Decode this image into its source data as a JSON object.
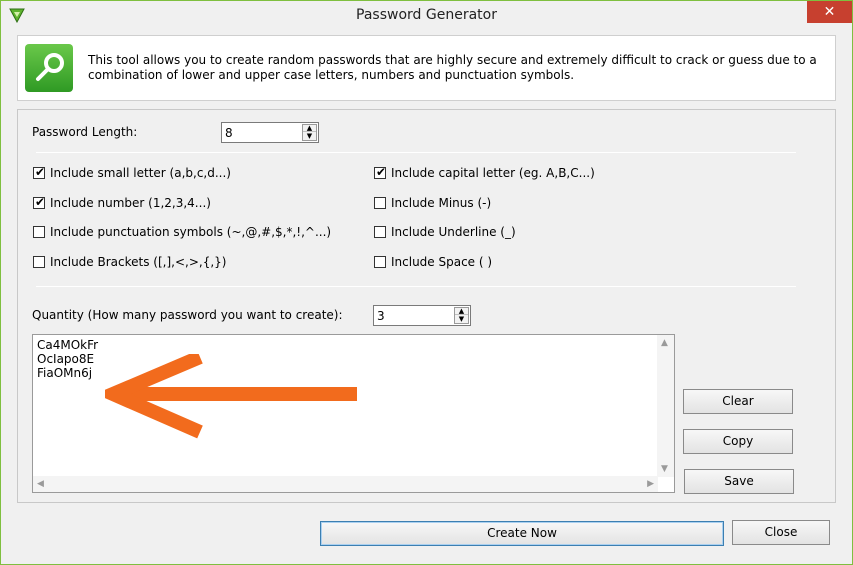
{
  "window": {
    "title": "Password Generator",
    "close_glyph": "✕",
    "accent": "#c7402f"
  },
  "info": {
    "icon": "search-key-icon",
    "text": "This tool allows you to create random passwords that are highly secure and extremely difficult to crack or guess due to a combination of lower and upper case letters, numbers and punctuation symbols."
  },
  "length": {
    "label": "Password Length:",
    "value": "8"
  },
  "options": {
    "small": {
      "label": "Include small letter (a,b,c,d...)",
      "checked": true
    },
    "capital": {
      "label": "Include capital letter (eg. A,B,C...)",
      "checked": true
    },
    "number": {
      "label": "Include number (1,2,3,4...)",
      "checked": true
    },
    "minus": {
      "label": "Include Minus (-)",
      "checked": false
    },
    "punct": {
      "label": "Include punctuation symbols (~,@,#,$,*,!,^...)",
      "checked": false
    },
    "underline": {
      "label": "Include Underline (_)",
      "checked": false
    },
    "brackets": {
      "label": "Include Brackets ([,],<,>,{,})",
      "checked": false
    },
    "space": {
      "label": "Include Space ( )",
      "checked": false
    }
  },
  "quantity": {
    "label": "Quantity (How many password you want to create):",
    "value": "3"
  },
  "passwords": [
    "Ca4MOkFr",
    "OcIapo8E",
    "FiaOMn6j"
  ],
  "buttons": {
    "clear": "Clear",
    "copy": "Copy",
    "save": "Save",
    "create": "Create Now",
    "close": "Close"
  },
  "tick_glyph": "✔",
  "annotation_color": "#f26b1d"
}
